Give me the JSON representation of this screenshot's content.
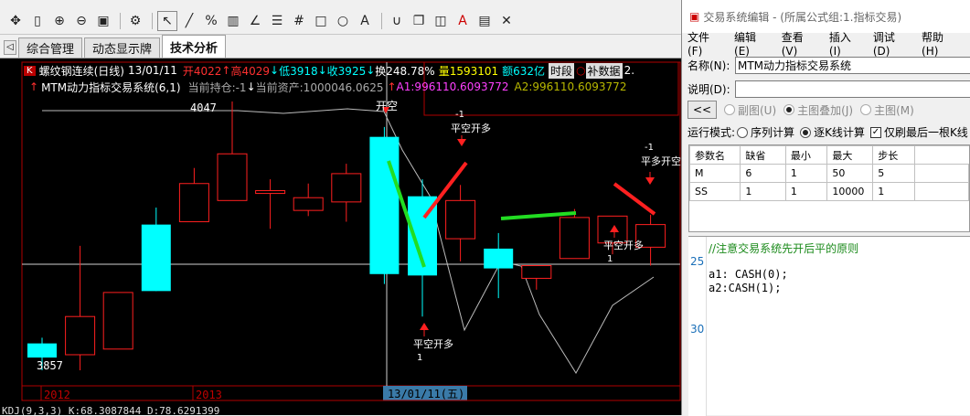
{
  "main_window": {
    "toolbar_icons": [
      "pointer-icon",
      "line-icon",
      "percent-icon",
      "ruler-icon",
      "angle-icon",
      "list-icon",
      "rect-icon",
      "circle-icon",
      "text-icon",
      "magnet-icon",
      "copy-icon",
      "font-color-icon",
      "save-icon",
      "close-icon"
    ],
    "tabs": [
      {
        "label": "综合管理",
        "active": false
      },
      {
        "label": "动态显示牌",
        "active": false
      },
      {
        "label": "技术分析",
        "active": true
      }
    ],
    "chart_header": {
      "k_badge": "K",
      "title": "螺纹钢连续(日线)",
      "date": "13/01/11",
      "open": "开4022",
      "high": "高4029",
      "low": "低3918",
      "close": "收3925",
      "turnover_rate": "换248.78%",
      "volume": "量1593101",
      "amount": "额632亿",
      "period_tag": "时段",
      "fill_tag": "补数据",
      "extra": "2."
    },
    "indicator_header": {
      "name": "MTM动力指标交易系统(6,1)",
      "position": "当前持仓:-1",
      "assets": "当前资产:1000046.0625",
      "a1": "A1:996110.6093772",
      "a2": "A2:996110.6093772"
    },
    "price_labels": {
      "high": "4047",
      "low": "3857"
    },
    "signal_labels": {
      "open_short": "开空",
      "flat_open_long": "平空开多",
      "flat_open_short": "平多开空",
      "minus_one": "-1",
      "one": "1"
    },
    "year_labels": [
      "2012",
      "2013"
    ],
    "cursor_date": "13/01/11(五)",
    "bottom_indicator": "KDJ(9,3,3) K:68.3087844 D:78.6291399"
  },
  "panel": {
    "title": "交易系统编辑 - (所属公式组:1.指标交易)",
    "menu": [
      "文件(F)",
      "编辑(E)",
      "查看(V)",
      "插入(I)",
      "调试(D)",
      "帮助(H)"
    ],
    "name_label": "名称(N):",
    "name_value": "MTM动力指标交易系统",
    "desc_label": "说明(D):",
    "desc_value": "",
    "collapse_button": "<<",
    "display_options": [
      {
        "label": "副图(U)",
        "selected": false,
        "enabled": false
      },
      {
        "label": "主图叠加(J)",
        "selected": true,
        "enabled": false
      },
      {
        "label": "主图(M)",
        "selected": false,
        "enabled": false
      }
    ],
    "run_mode_label": "运行模式:",
    "run_modes": [
      {
        "label": "序列计算",
        "selected": false
      },
      {
        "label": "逐K线计算",
        "selected": true
      }
    ],
    "refresh_last": "仅刷最后一根K线",
    "table_headers": [
      "参数名",
      "缺省",
      "最小",
      "最大",
      "步长"
    ],
    "table_rows": [
      [
        "M",
        "6",
        "1",
        "50",
        "5"
      ],
      [
        "SS",
        "1",
        "1",
        "10000",
        "1"
      ]
    ],
    "code_lines": [
      {
        "num": "",
        "text": "//注意交易系统先开后平的原则"
      },
      {
        "num": "25",
        "text": ""
      },
      {
        "num": "",
        "text": "a1: CASH(0);"
      },
      {
        "num": "",
        "text": "a2:CASH(1);"
      },
      {
        "num": "30",
        "text": ""
      }
    ]
  },
  "chart_data": {
    "type": "candlestick",
    "candles": [
      {
        "open": 3876,
        "close": 3866,
        "high": 3880,
        "low": 3857
      },
      {
        "open": 3868,
        "close": 3895,
        "high": 3945,
        "low": 3857
      },
      {
        "open": 3872,
        "close": 3912,
        "high": 3912,
        "low": 3872
      },
      {
        "open": 3960,
        "close": 3913,
        "high": 3972,
        "low": 3913
      },
      {
        "open": 3962,
        "close": 3989,
        "high": 4000,
        "low": 3962
      },
      {
        "open": 3977,
        "close": 4010,
        "high": 4047,
        "low": 3977
      },
      {
        "open": 3982,
        "close": 3984,
        "high": 3992,
        "low": 3957
      },
      {
        "open": 3970,
        "close": 3979,
        "high": 3989,
        "low": 3966
      },
      {
        "open": 3976,
        "close": 3996,
        "high": 4003,
        "low": 3962
      },
      {
        "open": 4022,
        "close": 3925,
        "high": 4029,
        "low": 3918
      },
      {
        "open": 3980,
        "close": 3924,
        "high": 3992,
        "low": 3895
      },
      {
        "open": 3950,
        "close": 3977,
        "high": 3988,
        "low": 3934
      },
      {
        "open": 3943,
        "close": 3929,
        "high": 3954,
        "low": 3908
      },
      {
        "open": 3922,
        "close": 3931,
        "high": 3931,
        "low": 3914
      },
      {
        "open": 3936,
        "close": 3965,
        "high": 3971,
        "low": 3936
      },
      {
        "open": 3947,
        "close": 3966,
        "high": 3966,
        "low": 3939
      },
      {
        "open": 3944,
        "close": 3960,
        "high": 3967,
        "low": 3931
      }
    ]
  }
}
